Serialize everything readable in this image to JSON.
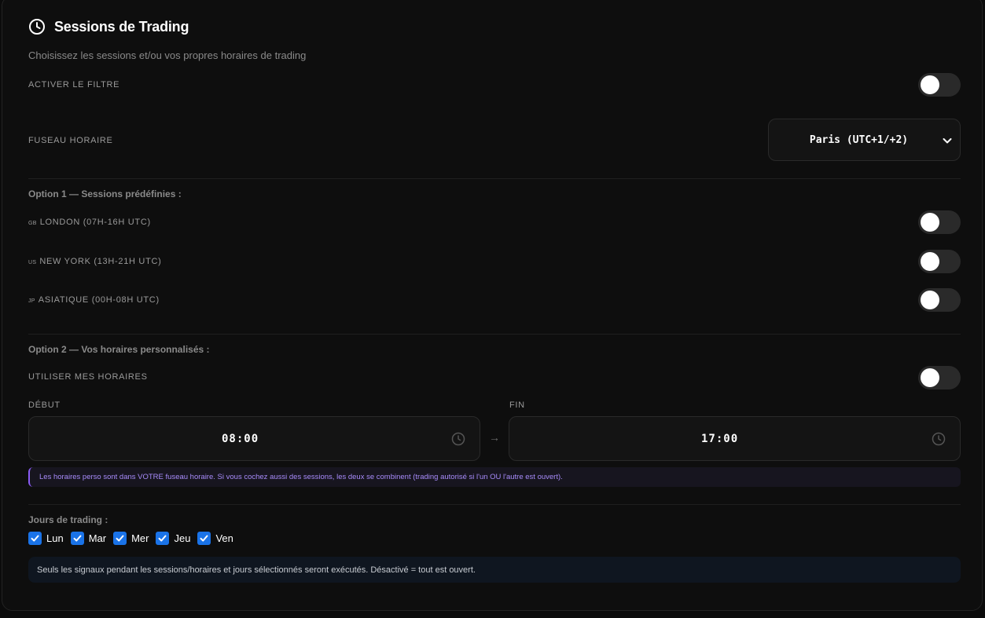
{
  "header": {
    "title": "Sessions de Trading",
    "subtitle": "Choisissez les sessions et/ou vos propres horaires de trading"
  },
  "filter": {
    "label": "ACTIVER LE FILTRE",
    "enabled": false
  },
  "timezone": {
    "label": "FUSEAU HORAIRE",
    "value": "Paris (UTC+1/+2)"
  },
  "option1": {
    "title": "Option 1 — Sessions prédéfinies :",
    "sessions": [
      {
        "flag": "GB",
        "label": "LONDON (07H-16H UTC)",
        "enabled": false
      },
      {
        "flag": "US",
        "label": "NEW YORK (13H-21H UTC)",
        "enabled": false
      },
      {
        "flag": "JP",
        "label": "ASIATIQUE (00H-08H UTC)",
        "enabled": false
      }
    ]
  },
  "option2": {
    "title": "Option 2 — Vos horaires personnalisés :",
    "use_custom_label": "UTILISER MES HORAIRES",
    "use_custom_enabled": false,
    "start_label": "DÉBUT",
    "start_value": "08:00",
    "end_label": "FIN",
    "end_value": "17:00",
    "arrow": "→",
    "note": "Les horaires perso sont dans VOTRE fuseau horaire. Si vous cochez aussi des sessions, les deux se combinent (trading autorisé si l'un OU l'autre est ouvert)."
  },
  "days": {
    "title": "Jours de trading :",
    "items": [
      {
        "label": "Lun",
        "checked": true
      },
      {
        "label": "Mar",
        "checked": true
      },
      {
        "label": "Mer",
        "checked": true
      },
      {
        "label": "Jeu",
        "checked": true
      },
      {
        "label": "Ven",
        "checked": true
      }
    ]
  },
  "footer_note": "Seuls les signaux pendant les sessions/horaires et jours sélectionnés seront exécutés. Désactivé = tout est ouvert.",
  "colors": {
    "background": "#0e0e0e",
    "toggle_off": "#2a2a2a",
    "checkbox": "#1a73e8",
    "accent_purple": "#8a5cf6"
  },
  "icons": {
    "title": "clock-icon",
    "dropdown": "chevron-down-icon",
    "time": "clock-icon"
  }
}
